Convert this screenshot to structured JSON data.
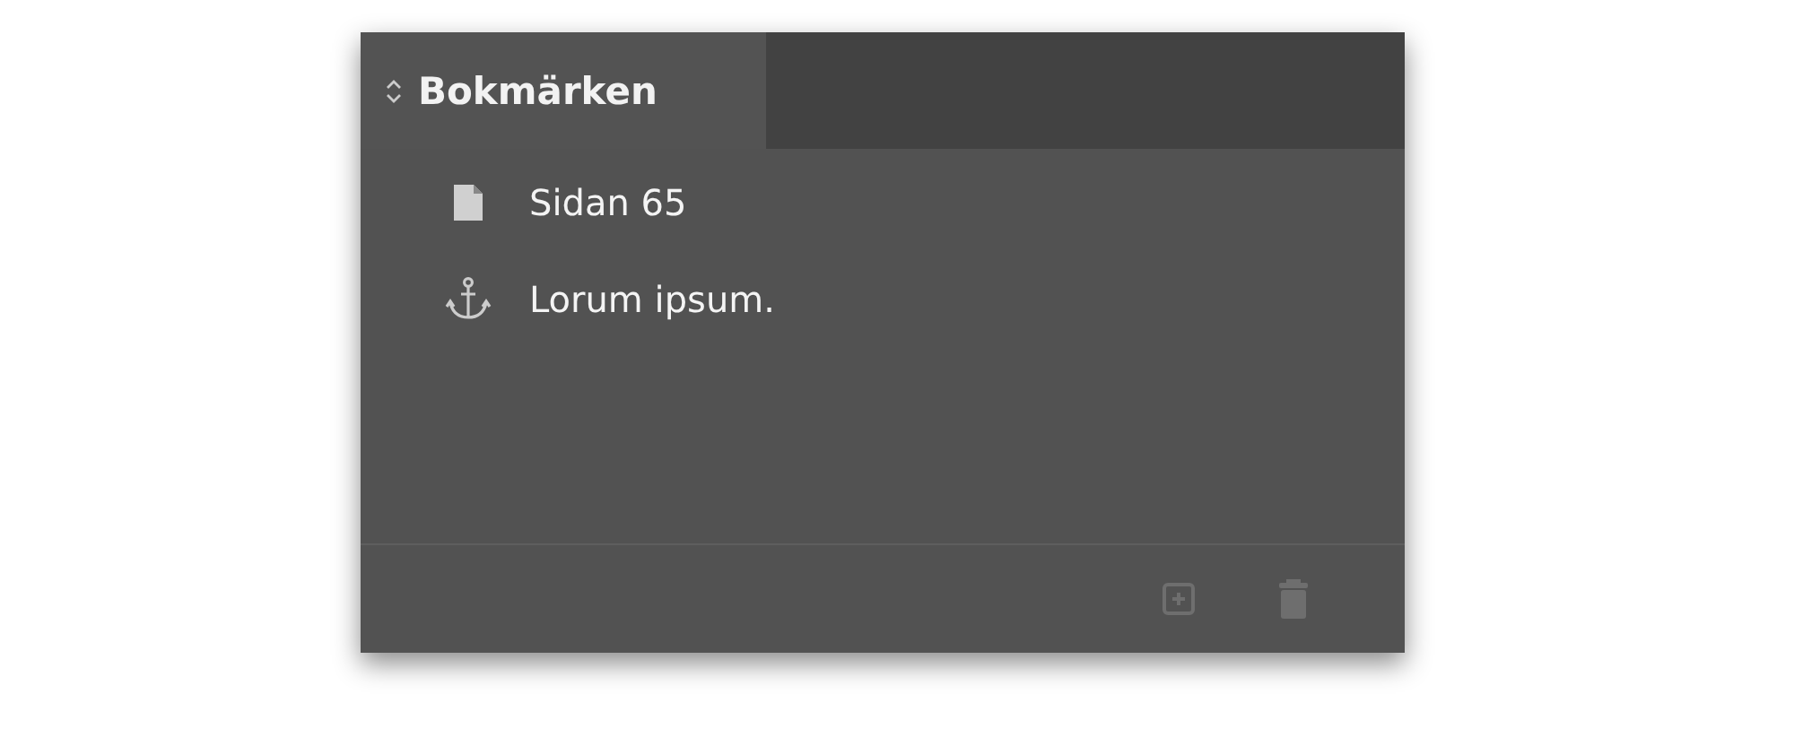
{
  "panel": {
    "tab": {
      "label": "Bokmärken"
    },
    "bookmarks": [
      {
        "kind": "page",
        "label": "Sidan 65"
      },
      {
        "kind": "anchor",
        "label": "Lorum ipsum."
      }
    ],
    "footer_buttons": [
      {
        "kind": "new",
        "disabled": true
      },
      {
        "kind": "delete",
        "disabled": true
      }
    ]
  }
}
